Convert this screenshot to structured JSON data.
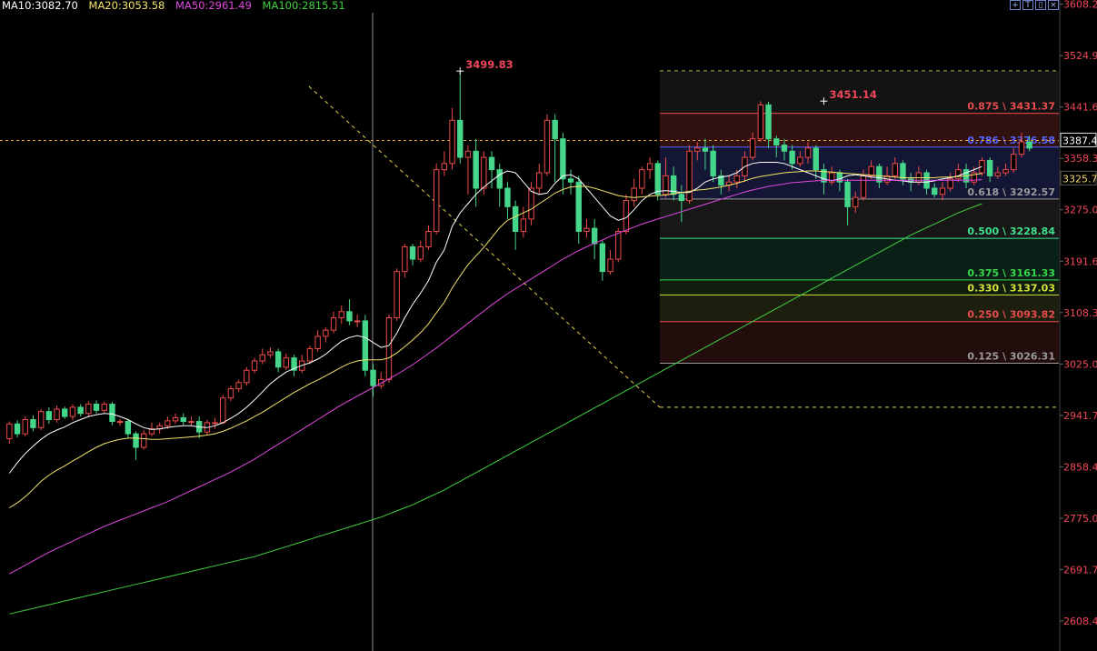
{
  "legend": {
    "ma10": {
      "label": "MA10:3082.70",
      "color": "#ffffff"
    },
    "ma20": {
      "label": "MA20:3053.58",
      "color": "#f2e36b"
    },
    "ma50": {
      "label": "MA50:2961.49",
      "color": "#e048e0"
    },
    "ma100": {
      "label": "MA100:2815.51",
      "color": "#3fd13f"
    }
  },
  "toolbar": {
    "icons": [
      "crosshair-icon",
      "text-note-icon",
      "price-label-icon",
      "close-icon"
    ]
  },
  "colors": {
    "up": "#ef4a4a",
    "down": "#45d68a",
    "axis": "#f2475a",
    "crosshair": "#8a8f99",
    "dash": "#e8d24a"
  },
  "chart_data": {
    "type": "candlestick",
    "ylim": [
      2560,
      3615
    ],
    "y_ticks": [
      "3608.2",
      "3524.9",
      "3441.6",
      "3358.3",
      "3275.0",
      "3191.6",
      "3108.3",
      "3025.0",
      "2941.7",
      "2858.4",
      "2775.0",
      "2691.7",
      "2608.4"
    ],
    "current_price_label": "3387.4",
    "current_price": 3387.4,
    "crosshair_price_label": "3325.7",
    "crosshair_price": 3325.7,
    "annotations": {
      "high1": {
        "label": "3499.83",
        "price": 3499.83
      },
      "high2": {
        "label": "3451.14",
        "price": 3451.14
      }
    },
    "fibonacci": {
      "top": 3500,
      "bottom": 2955,
      "levels": [
        {
          "label": "0.875 \\ 3431.37",
          "price": 3431.37,
          "color": "#e84c4c"
        },
        {
          "label": "0.786 \\ 3376.58",
          "price": 3376.58,
          "color": "#5566ff"
        },
        {
          "label": "0.618 \\ 3292.57",
          "price": 3292.57,
          "color": "#9a9a9a"
        },
        {
          "label": "0.500 \\ 3228.84",
          "price": 3228.84,
          "color": "#3fe08e"
        },
        {
          "label": "0.375 \\ 3161.33",
          "price": 3161.33,
          "color": "#3ad74c"
        },
        {
          "label": "0.330 \\ 3137.03",
          "price": 3137.03,
          "color": "#d8e03a"
        },
        {
          "label": "0.250 \\ 3093.82",
          "price": 3093.82,
          "color": "#e84c4c"
        },
        {
          "label": "0.125 \\ 3026.31",
          "price": 3026.31,
          "color": "#9a9a9a"
        }
      ]
    },
    "candles": [
      [
        2904,
        2928,
        2896,
        2932
      ],
      [
        2928,
        2912,
        2906,
        2934
      ],
      [
        2912,
        2935,
        2908,
        2940
      ],
      [
        2935,
        2922,
        2916,
        2942
      ],
      [
        2922,
        2948,
        2918,
        2952
      ],
      [
        2948,
        2935,
        2928,
        2955
      ],
      [
        2935,
        2952,
        2930,
        2958
      ],
      [
        2952,
        2940,
        2936,
        2956
      ],
      [
        2940,
        2955,
        2934,
        2960
      ],
      [
        2955,
        2945,
        2940,
        2960
      ],
      [
        2945,
        2960,
        2940,
        2965
      ],
      [
        2960,
        2950,
        2945,
        2966
      ],
      [
        2950,
        2960,
        2946,
        2964
      ],
      [
        2960,
        2932,
        2926,
        2964
      ],
      [
        2932,
        2932,
        2925,
        2936
      ],
      [
        2932,
        2912,
        2905,
        2936
      ],
      [
        2912,
        2890,
        2870,
        2916
      ],
      [
        2890,
        2912,
        2886,
        2918
      ],
      [
        2912,
        2920,
        2908,
        2930
      ],
      [
        2920,
        2925,
        2912,
        2930
      ],
      [
        2925,
        2933,
        2920,
        2940
      ],
      [
        2933,
        2938,
        2928,
        2945
      ],
      [
        2938,
        2932,
        2926,
        2945
      ],
      [
        2932,
        2932,
        2925,
        2940
      ],
      [
        2932,
        2915,
        2905,
        2940
      ],
      [
        2915,
        2930,
        2910,
        2935
      ],
      [
        2930,
        2930,
        2920,
        2938
      ],
      [
        2930,
        2970,
        2928,
        2975
      ],
      [
        2970,
        2985,
        2965,
        2990
      ],
      [
        2985,
        2995,
        2980,
        3000
      ],
      [
        2995,
        3015,
        2990,
        3020
      ],
      [
        3015,
        3030,
        3010,
        3035
      ],
      [
        3030,
        3040,
        3025,
        3050
      ],
      [
        3040,
        3045,
        3035,
        3052
      ],
      [
        3045,
        3020,
        3012,
        3050
      ],
      [
        3020,
        3035,
        3015,
        3042
      ],
      [
        3035,
        3015,
        3005,
        3040
      ],
      [
        3015,
        3030,
        3010,
        3040
      ],
      [
        3030,
        3050,
        3025,
        3055
      ],
      [
        3050,
        3070,
        3045,
        3080
      ],
      [
        3070,
        3080,
        3060,
        3085
      ],
      [
        3080,
        3100,
        3075,
        3110
      ],
      [
        3100,
        3110,
        3090,
        3120
      ],
      [
        3110,
        3095,
        3088,
        3130
      ],
      [
        3095,
        3095,
        3085,
        3105
      ],
      [
        3095,
        3015,
        3005,
        3105
      ],
      [
        3015,
        2990,
        2972,
        3025
      ],
      [
        2990,
        3000,
        2985,
        3012
      ],
      [
        3000,
        3100,
        2995,
        3105
      ],
      [
        3100,
        3175,
        3095,
        3180
      ],
      [
        3175,
        3215,
        3165,
        3220
      ],
      [
        3215,
        3195,
        3185,
        3220
      ],
      [
        3195,
        3215,
        3190,
        3225
      ],
      [
        3215,
        3240,
        3210,
        3250
      ],
      [
        3240,
        3340,
        3235,
        3350
      ],
      [
        3340,
        3350,
        3330,
        3370
      ],
      [
        3350,
        3420,
        3340,
        3440
      ],
      [
        3420,
        3360,
        3350,
        3500
      ],
      [
        3360,
        3370,
        3300,
        3380
      ],
      [
        3370,
        3310,
        3280,
        3390
      ],
      [
        3310,
        3360,
        3300,
        3370
      ],
      [
        3360,
        3340,
        3310,
        3370
      ],
      [
        3340,
        3310,
        3280,
        3350
      ],
      [
        3310,
        3280,
        3260,
        3320
      ],
      [
        3280,
        3240,
        3210,
        3290
      ],
      [
        3240,
        3260,
        3230,
        3280
      ],
      [
        3260,
        3310,
        3250,
        3320
      ],
      [
        3310,
        3335,
        3300,
        3350
      ],
      [
        3335,
        3420,
        3330,
        3430
      ],
      [
        3420,
        3390,
        3320,
        3430
      ],
      [
        3390,
        3325,
        3300,
        3400
      ],
      [
        3325,
        3320,
        3300,
        3340
      ],
      [
        3320,
        3240,
        3220,
        3330
      ],
      [
        3240,
        3245,
        3230,
        3260
      ],
      [
        3245,
        3220,
        3195,
        3260
      ],
      [
        3220,
        3175,
        3160,
        3225
      ],
      [
        3175,
        3195,
        3170,
        3210
      ],
      [
        3195,
        3240,
        3190,
        3245
      ],
      [
        3240,
        3290,
        3235,
        3300
      ],
      [
        3290,
        3310,
        3280,
        3325
      ],
      [
        3310,
        3340,
        3300,
        3345
      ],
      [
        3340,
        3350,
        3325,
        3360
      ],
      [
        3350,
        3300,
        3290,
        3355
      ],
      [
        3300,
        3330,
        3295,
        3360
      ],
      [
        3330,
        3300,
        3290,
        3345
      ],
      [
        3300,
        3290,
        3255,
        3315
      ],
      [
        3290,
        3370,
        3285,
        3380
      ],
      [
        3370,
        3375,
        3355,
        3385
      ],
      [
        3375,
        3370,
        3340,
        3390
      ],
      [
        3370,
        3330,
        3320,
        3380
      ],
      [
        3330,
        3315,
        3300,
        3340
      ],
      [
        3315,
        3320,
        3305,
        3330
      ],
      [
        3320,
        3330,
        3310,
        3340
      ],
      [
        3330,
        3360,
        3320,
        3370
      ],
      [
        3360,
        3390,
        3355,
        3400
      ],
      [
        3390,
        3445,
        3385,
        3451
      ],
      [
        3445,
        3390,
        3375,
        3450
      ],
      [
        3390,
        3380,
        3360,
        3395
      ],
      [
        3380,
        3370,
        3355,
        3390
      ],
      [
        3370,
        3350,
        3340,
        3380
      ],
      [
        3350,
        3360,
        3345,
        3370
      ],
      [
        3360,
        3375,
        3350,
        3385
      ],
      [
        3375,
        3340,
        3325,
        3380
      ],
      [
        3340,
        3320,
        3300,
        3350
      ],
      [
        3320,
        3335,
        3315,
        3345
      ],
      [
        3335,
        3320,
        3305,
        3340
      ],
      [
        3320,
        3280,
        3250,
        3325
      ],
      [
        3280,
        3295,
        3270,
        3305
      ],
      [
        3295,
        3330,
        3290,
        3340
      ],
      [
        3330,
        3345,
        3325,
        3355
      ],
      [
        3345,
        3320,
        3310,
        3350
      ],
      [
        3320,
        3330,
        3315,
        3345
      ],
      [
        3330,
        3350,
        3325,
        3360
      ],
      [
        3350,
        3325,
        3315,
        3355
      ],
      [
        3325,
        3320,
        3305,
        3335
      ],
      [
        3320,
        3335,
        3315,
        3345
      ],
      [
        3335,
        3310,
        3300,
        3340
      ],
      [
        3310,
        3300,
        3295,
        3318
      ],
      [
        3300,
        3310,
        3290,
        3320
      ],
      [
        3310,
        3325,
        3305,
        3335
      ],
      [
        3325,
        3340,
        3320,
        3350
      ],
      [
        3340,
        3320,
        3310,
        3350
      ],
      [
        3320,
        3335,
        3315,
        3345
      ],
      [
        3335,
        3355,
        3330,
        3360
      ],
      [
        3355,
        3330,
        3320,
        3360
      ],
      [
        3330,
        3335,
        3325,
        3345
      ],
      [
        3335,
        3340,
        3330,
        3350
      ],
      [
        3340,
        3365,
        3335,
        3375
      ],
      [
        3365,
        3385,
        3360,
        3400
      ],
      [
        3385,
        3375,
        3370,
        3395
      ]
    ],
    "moving_averages": {
      "ma10": [
        2848,
        2865,
        2880,
        2892,
        2903,
        2912,
        2918,
        2923,
        2930,
        2935,
        2940,
        2943,
        2945,
        2944,
        2940,
        2935,
        2928,
        2922,
        2919,
        2920,
        2922,
        2924,
        2925,
        2925,
        2923,
        2922,
        2925,
        2930,
        2937,
        2945,
        2955,
        2967,
        2980,
        2993,
        3003,
        3012,
        3018,
        3023,
        3027,
        3033,
        3041,
        3052,
        3062,
        3068,
        3071,
        3068,
        3060,
        3052,
        3055,
        3075,
        3100,
        3122,
        3140,
        3160,
        3190,
        3210,
        3248,
        3270,
        3285,
        3300,
        3312,
        3322,
        3332,
        3338,
        3335,
        3320,
        3305,
        3300,
        3302,
        3318,
        3330,
        3332,
        3325,
        3310,
        3295,
        3280,
        3265,
        3258,
        3262,
        3275,
        3290,
        3300,
        3305,
        3306,
        3305,
        3303,
        3303,
        3310,
        3320,
        3325,
        3328,
        3330,
        3335,
        3345,
        3350,
        3352,
        3352,
        3352,
        3350,
        3345,
        3340,
        3335,
        3330,
        3325,
        3322,
        3325,
        3330,
        3332,
        3330,
        3328,
        3327,
        3325,
        3323,
        3322,
        3320,
        3320,
        3320,
        3322,
        3325,
        3327,
        3330,
        3335,
        3340,
        3345
      ],
      "ma20": [
        2792,
        2800,
        2810,
        2822,
        2835,
        2845,
        2853,
        2860,
        2868,
        2875,
        2883,
        2890,
        2896,
        2900,
        2903,
        2905,
        2905,
        2904,
        2903,
        2903,
        2904,
        2905,
        2906,
        2907,
        2908,
        2910,
        2912,
        2916,
        2921,
        2927,
        2933,
        2940,
        2947,
        2955,
        2963,
        2971,
        2979,
        2986,
        2993,
        2999,
        3006,
        3013,
        3020,
        3026,
        3030,
        3032,
        3032,
        3032,
        3035,
        3043,
        3053,
        3064,
        3076,
        3090,
        3108,
        3125,
        3148,
        3168,
        3186,
        3200,
        3214,
        3230,
        3246,
        3258,
        3264,
        3270,
        3276,
        3285,
        3293,
        3302,
        3308,
        3312,
        3313,
        3313,
        3310,
        3306,
        3302,
        3298,
        3296,
        3295,
        3296,
        3297,
        3298,
        3299,
        3301,
        3303,
        3305,
        3307,
        3308,
        3310,
        3312,
        3315,
        3318,
        3322,
        3326,
        3329,
        3331,
        3333,
        3335,
        3336,
        3337,
        3338,
        3338,
        3337,
        3336,
        3335,
        3334,
        3333,
        3332,
        3331,
        3330,
        3329,
        3328,
        3327,
        3327,
        3327,
        3327,
        3327,
        3328,
        3328,
        3329,
        3330,
        3332,
        3334
      ],
      "ma50": [
        2685,
        2692,
        2699,
        2706,
        2713,
        2720,
        2726,
        2732,
        2738,
        2744,
        2750,
        2756,
        2762,
        2767,
        2772,
        2777,
        2782,
        2787,
        2792,
        2797,
        2802,
        2808,
        2814,
        2820,
        2826,
        2832,
        2838,
        2844,
        2850,
        2857,
        2864,
        2871,
        2879,
        2887,
        2895,
        2903,
        2911,
        2919,
        2927,
        2935,
        2943,
        2951,
        2959,
        2966,
        2973,
        2980,
        2987,
        2994,
        3001,
        3008,
        3016,
        3024,
        3033,
        3042,
        3051,
        3061,
        3071,
        3081,
        3091,
        3101,
        3111,
        3121,
        3130,
        3139,
        3147,
        3155,
        3163,
        3171,
        3179,
        3187,
        3195,
        3202,
        3209,
        3215,
        3221,
        3226,
        3232,
        3237,
        3242,
        3247,
        3252,
        3256,
        3260,
        3264,
        3268,
        3272,
        3276,
        3280,
        3284,
        3288,
        3292,
        3296,
        3300,
        3304,
        3307,
        3310,
        3313,
        3315,
        3317,
        3319,
        3320,
        3321,
        3322,
        3323,
        3323,
        3323,
        3323,
        3323,
        3323,
        3323,
        3323,
        3323,
        3323,
        3323,
        3323,
        3323,
        3323,
        3323,
        3323,
        3323,
        3323,
        3323,
        3323,
        3324
      ],
      "ma100": [
        2620,
        2623,
        2626,
        2629,
        2632,
        2635,
        2638,
        2641,
        2644,
        2647,
        2650,
        2653,
        2656,
        2659,
        2662,
        2665,
        2668,
        2671,
        2674,
        2677,
        2680,
        2683,
        2686,
        2689,
        2692,
        2695,
        2698,
        2701,
        2704,
        2707,
        2710,
        2713,
        2717,
        2721,
        2725,
        2729,
        2733,
        2737,
        2741,
        2745,
        2749,
        2753,
        2757,
        2761,
        2765,
        2769,
        2773,
        2777,
        2782,
        2787,
        2792,
        2797,
        2803,
        2809,
        2815,
        2821,
        2828,
        2835,
        2842,
        2849,
        2856,
        2863,
        2870,
        2877,
        2884,
        2891,
        2898,
        2905,
        2912,
        2919,
        2926,
        2933,
        2940,
        2947,
        2954,
        2961,
        2968,
        2975,
        2982,
        2989,
        2996,
        3003,
        3010,
        3017,
        3024,
        3031,
        3038,
        3045,
        3052,
        3059,
        3066,
        3073,
        3080,
        3087,
        3094,
        3101,
        3108,
        3115,
        3122,
        3129,
        3136,
        3143,
        3150,
        3157,
        3164,
        3171,
        3178,
        3185,
        3192,
        3199,
        3206,
        3213,
        3220,
        3227,
        3234,
        3240,
        3246,
        3252,
        3258,
        3264,
        3270,
        3275,
        3280,
        3285
      ]
    }
  }
}
